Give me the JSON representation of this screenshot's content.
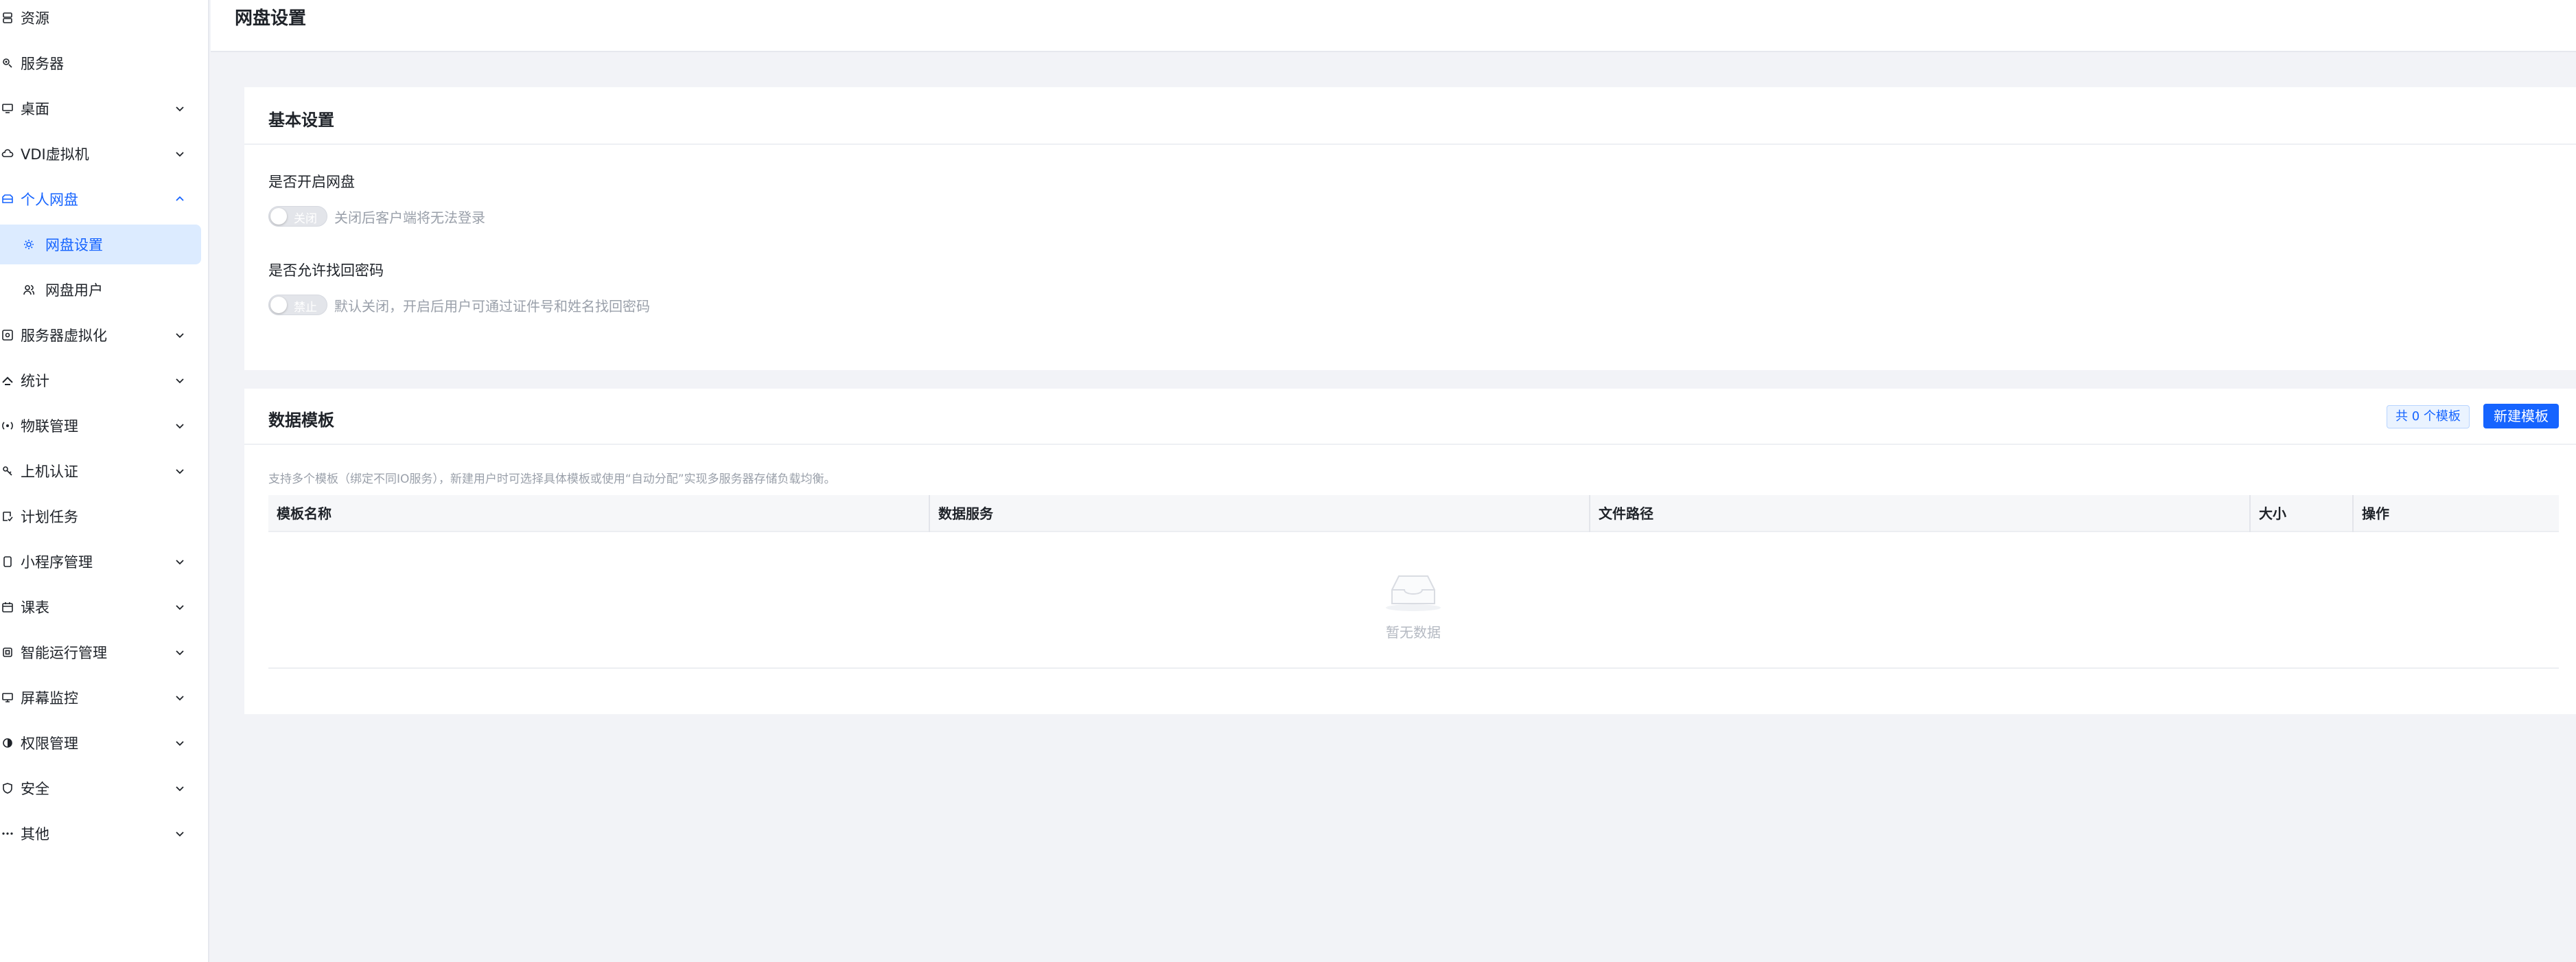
{
  "header": {
    "title": "网盘设置"
  },
  "sidebar": {
    "items": [
      {
        "label": "资源",
        "icon": "database-icon",
        "has_chevron": false
      },
      {
        "label": "服务器",
        "icon": "server-icon",
        "has_chevron": false
      },
      {
        "label": "桌面",
        "icon": "desktop-icon",
        "has_chevron": true
      },
      {
        "label": "VDI虚拟机",
        "icon": "cloud-icon",
        "has_chevron": true
      },
      {
        "label": "个人网盘",
        "icon": "drive-icon",
        "has_chevron": true,
        "expanded": true
      },
      {
        "label": "网盘设置",
        "icon": "gear-icon",
        "sub": true,
        "active": true
      },
      {
        "label": "网盘用户",
        "icon": "users-icon",
        "sub": true
      },
      {
        "label": "服务器虚拟化",
        "icon": "virtualization-icon",
        "has_chevron": true
      },
      {
        "label": "统计",
        "icon": "stats-icon",
        "has_chevron": true
      },
      {
        "label": "物联管理",
        "icon": "iot-icon",
        "has_chevron": true
      },
      {
        "label": "上机认证",
        "icon": "auth-icon",
        "has_chevron": true
      },
      {
        "label": "计划任务",
        "icon": "task-icon",
        "has_chevron": false
      },
      {
        "label": "小程序管理",
        "icon": "miniapp-icon",
        "has_chevron": true
      },
      {
        "label": "课表",
        "icon": "calendar-icon",
        "has_chevron": true
      },
      {
        "label": "智能运行管理",
        "icon": "smart-ops-icon",
        "has_chevron": true
      },
      {
        "label": "屏幕监控",
        "icon": "monitor-icon",
        "has_chevron": true
      },
      {
        "label": "权限管理",
        "icon": "permission-icon",
        "has_chevron": true
      },
      {
        "label": "安全",
        "icon": "shield-icon",
        "has_chevron": true
      },
      {
        "label": "其他",
        "icon": "more-icon",
        "has_chevron": true
      }
    ]
  },
  "basic": {
    "title": "基本设置",
    "enable_drive": {
      "label": "是否开启网盘",
      "switch_text": "关闭",
      "hint": "关闭后客户端将无法登录",
      "on": false
    },
    "allow_reset": {
      "label": "是否允许找回密码",
      "switch_text": "禁止",
      "hint": "默认关闭，开启后用户可通过证件号和姓名找回密码",
      "on": false
    }
  },
  "templates": {
    "title": "数据模板",
    "count_badge": "共 0 个模板",
    "new_button": "新建模板",
    "description": "支持多个模板（绑定不同IO服务），新建用户时可选择具体模板或使用“自动分配”实现多服务器存储负载均衡。",
    "columns": [
      "模板名称",
      "数据服务",
      "文件路径",
      "大小",
      "操作"
    ],
    "rows": [],
    "empty_text": "暂无数据"
  },
  "colors": {
    "accent": "#1664ff",
    "active_bg": "#dcebff",
    "page_bg": "#f2f3f7"
  }
}
